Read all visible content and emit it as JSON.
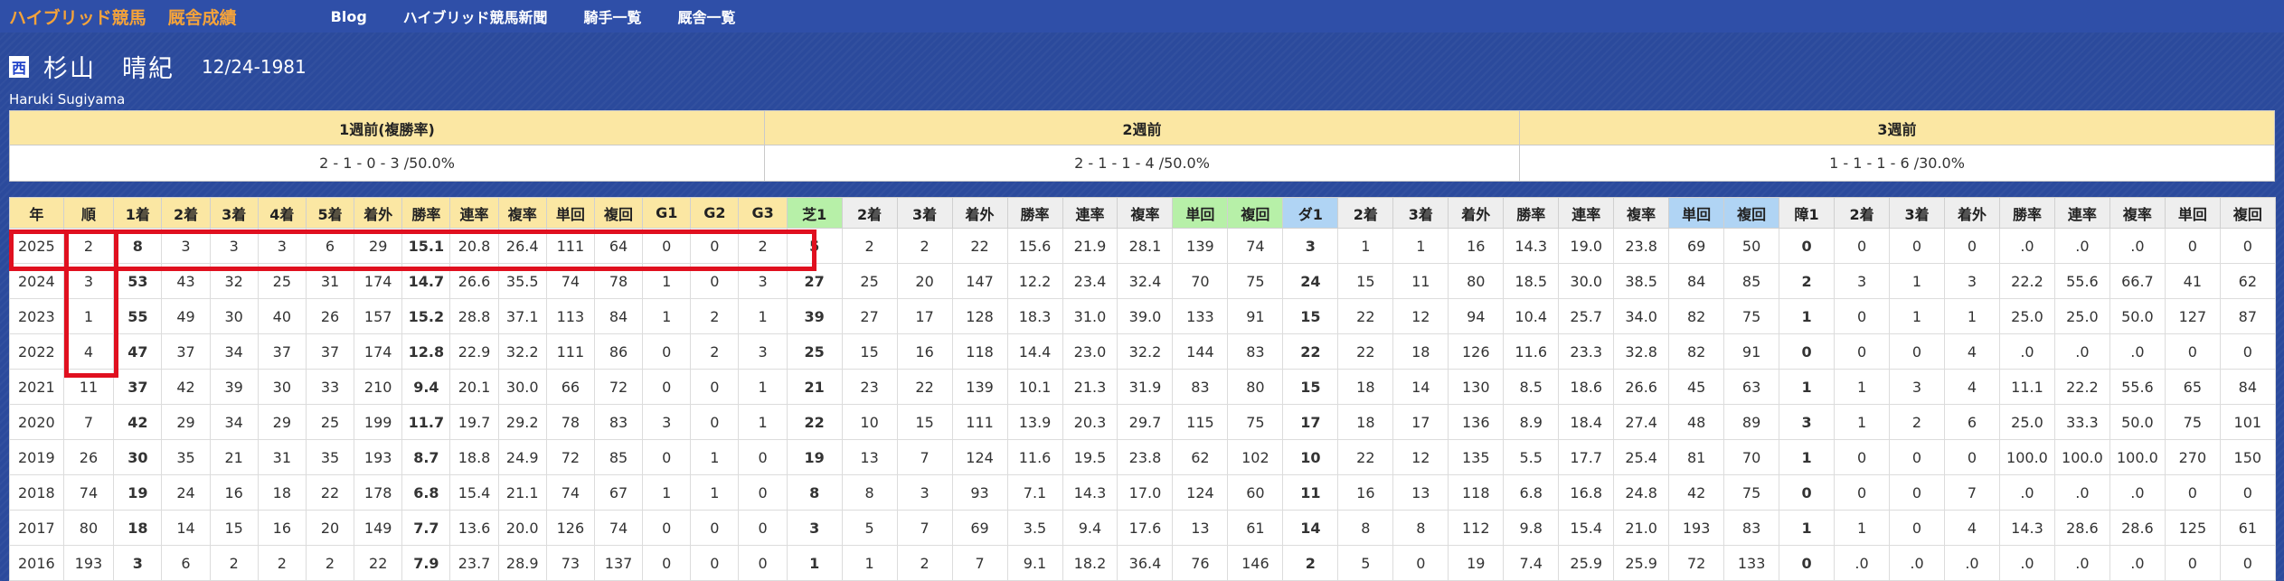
{
  "nav": {
    "brand": "ハイブリッド競馬",
    "section": "厩舎成績",
    "links": [
      "Blog",
      "ハイブリッド競馬新聞",
      "騎手一覧",
      "厩舎一覧"
    ]
  },
  "profile": {
    "badge": "西",
    "name": "杉山　晴紀",
    "birth": "12/24-1981",
    "romaji": "Haruki Sugiyama"
  },
  "recent": {
    "headers": [
      "1週前(複勝率)",
      "2週前",
      "3週前"
    ],
    "values": [
      "2 - 1 - 0 - 3 /50.0%",
      "2 - 1 - 1 - 4 /50.0%",
      "1 - 1 - 1 - 6 /30.0%"
    ]
  },
  "stats": {
    "headers": [
      "年",
      "順",
      "1着",
      "2着",
      "3着",
      "4着",
      "5着",
      "着外",
      "勝率",
      "連率",
      "複率",
      "単回",
      "複回",
      "G1",
      "G2",
      "G3",
      "芝1",
      "2着",
      "3着",
      "着外",
      "勝率",
      "連率",
      "複率",
      "単回",
      "複回",
      "ダ1",
      "2着",
      "3着",
      "着外",
      "勝率",
      "連率",
      "複率",
      "単回",
      "複回",
      "障1",
      "2着",
      "3着",
      "着外",
      "勝率",
      "連率",
      "複率",
      "単回",
      "複回"
    ],
    "rows": [
      [
        "2025",
        "2",
        "8",
        "3",
        "3",
        "3",
        "6",
        "29",
        "15.1",
        "20.8",
        "26.4",
        "111",
        "64",
        "0",
        "0",
        "2",
        "5",
        "2",
        "2",
        "22",
        "15.6",
        "21.9",
        "28.1",
        "139",
        "74",
        "3",
        "1",
        "1",
        "16",
        "14.3",
        "19.0",
        "23.8",
        "69",
        "50",
        "0",
        "0",
        "0",
        "0",
        ".0",
        ".0",
        ".0",
        "0",
        "0"
      ],
      [
        "2024",
        "3",
        "53",
        "43",
        "32",
        "25",
        "31",
        "174",
        "14.7",
        "26.6",
        "35.5",
        "74",
        "78",
        "1",
        "0",
        "3",
        "27",
        "25",
        "20",
        "147",
        "12.2",
        "23.4",
        "32.4",
        "70",
        "75",
        "24",
        "15",
        "11",
        "80",
        "18.5",
        "30.0",
        "38.5",
        "84",
        "85",
        "2",
        "3",
        "1",
        "3",
        "22.2",
        "55.6",
        "66.7",
        "41",
        "62"
      ],
      [
        "2023",
        "1",
        "55",
        "49",
        "30",
        "40",
        "26",
        "157",
        "15.2",
        "28.8",
        "37.1",
        "113",
        "84",
        "1",
        "2",
        "1",
        "39",
        "27",
        "17",
        "128",
        "18.3",
        "31.0",
        "39.0",
        "133",
        "91",
        "15",
        "22",
        "12",
        "94",
        "10.4",
        "25.7",
        "34.0",
        "82",
        "75",
        "1",
        "0",
        "1",
        "1",
        "25.0",
        "25.0",
        "50.0",
        "127",
        "87"
      ],
      [
        "2022",
        "4",
        "47",
        "37",
        "34",
        "37",
        "37",
        "174",
        "12.8",
        "22.9",
        "32.2",
        "111",
        "86",
        "0",
        "2",
        "3",
        "25",
        "15",
        "16",
        "118",
        "14.4",
        "23.0",
        "32.2",
        "144",
        "83",
        "22",
        "22",
        "18",
        "126",
        "11.6",
        "23.3",
        "32.8",
        "82",
        "91",
        "0",
        "0",
        "0",
        "4",
        ".0",
        ".0",
        ".0",
        "0",
        "0"
      ],
      [
        "2021",
        "11",
        "37",
        "42",
        "39",
        "30",
        "33",
        "210",
        "9.4",
        "20.1",
        "30.0",
        "66",
        "72",
        "0",
        "0",
        "1",
        "21",
        "23",
        "22",
        "139",
        "10.1",
        "21.3",
        "31.9",
        "83",
        "80",
        "15",
        "18",
        "14",
        "130",
        "8.5",
        "18.6",
        "26.6",
        "45",
        "63",
        "1",
        "1",
        "3",
        "4",
        "11.1",
        "22.2",
        "55.6",
        "65",
        "84"
      ],
      [
        "2020",
        "7",
        "42",
        "29",
        "34",
        "29",
        "25",
        "199",
        "11.7",
        "19.7",
        "29.2",
        "78",
        "83",
        "3",
        "0",
        "1",
        "22",
        "10",
        "15",
        "111",
        "13.9",
        "20.3",
        "29.7",
        "115",
        "75",
        "17",
        "18",
        "17",
        "136",
        "8.9",
        "18.4",
        "27.4",
        "48",
        "89",
        "3",
        "1",
        "2",
        "6",
        "25.0",
        "33.3",
        "50.0",
        "75",
        "101"
      ],
      [
        "2019",
        "26",
        "30",
        "35",
        "21",
        "31",
        "35",
        "193",
        "8.7",
        "18.8",
        "24.9",
        "72",
        "85",
        "0",
        "1",
        "0",
        "19",
        "13",
        "7",
        "124",
        "11.6",
        "19.5",
        "23.8",
        "62",
        "102",
        "10",
        "22",
        "12",
        "135",
        "5.5",
        "17.7",
        "25.4",
        "81",
        "70",
        "1",
        "0",
        "0",
        "0",
        "100.0",
        "100.0",
        "100.0",
        "270",
        "150"
      ],
      [
        "2018",
        "74",
        "19",
        "24",
        "16",
        "18",
        "22",
        "178",
        "6.8",
        "15.4",
        "21.1",
        "74",
        "67",
        "1",
        "1",
        "0",
        "8",
        "8",
        "3",
        "93",
        "7.1",
        "14.3",
        "17.0",
        "124",
        "60",
        "11",
        "16",
        "13",
        "118",
        "6.8",
        "16.8",
        "24.8",
        "42",
        "75",
        "0",
        "0",
        "0",
        "7",
        ".0",
        ".0",
        ".0",
        "0",
        "0"
      ],
      [
        "2017",
        "80",
        "18",
        "14",
        "15",
        "16",
        "20",
        "149",
        "7.7",
        "13.6",
        "20.0",
        "126",
        "74",
        "0",
        "0",
        "0",
        "3",
        "5",
        "7",
        "69",
        "3.5",
        "9.4",
        "17.6",
        "13",
        "61",
        "14",
        "8",
        "8",
        "112",
        "9.8",
        "15.4",
        "21.0",
        "193",
        "83",
        "1",
        "1",
        "0",
        "4",
        "14.3",
        "28.6",
        "28.6",
        "125",
        "61"
      ],
      [
        "2016",
        "193",
        "3",
        "6",
        "2",
        "2",
        "2",
        "22",
        "7.9",
        "23.7",
        "28.9",
        "73",
        "137",
        "0",
        "0",
        "0",
        "1",
        "1",
        "2",
        "7",
        "9.1",
        "18.2",
        "36.4",
        "76",
        "146",
        "2",
        "5",
        "0",
        "19",
        "7.4",
        "25.9",
        "25.9",
        "72",
        "133",
        "0",
        ".0",
        ".0",
        ".0",
        ".0",
        ".0",
        ".0",
        "0",
        "0"
      ]
    ]
  },
  "colors": {
    "background": "#2b4a9c",
    "brand": "#f5a33a",
    "header_yellow": "#fbe7a3",
    "header_green": "#b7f0a8",
    "header_blue": "#b0d4f4",
    "highlight": "#e0101f"
  }
}
